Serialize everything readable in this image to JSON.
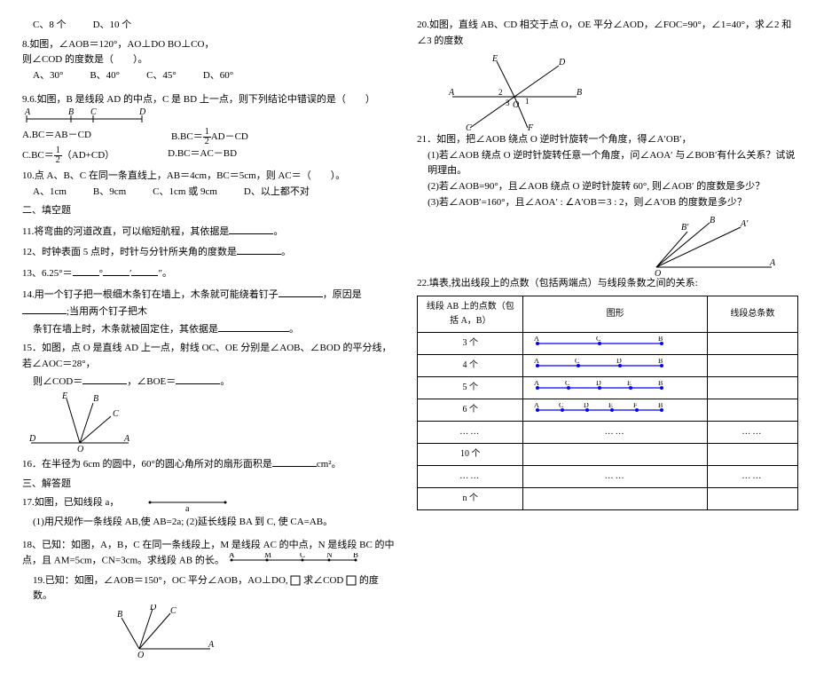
{
  "left": {
    "q7opts": {
      "c": "C、8 个",
      "d": "D、10 个"
    },
    "q8": {
      "line1": "8.如图，∠AOB＝120°，AO⊥DO BO⊥CO，",
      "line2": "则∠COD 的度数是（　　）。",
      "opts": {
        "a": "A、30°",
        "b": "B、40°",
        "c": "C、45°",
        "d": "D、60°"
      }
    },
    "q9": {
      "title": "9.6.如图，B 是线段 AD 的中点，C 是 BD 上一点，则下列结论中错误的是（　　）",
      "opts": {
        "a": "A.BC＝AB－CD",
        "b_pre": "B.BC＝",
        "b_post": "AD－CD",
        "c_pre": "C.BC＝",
        "c_post": "（AD+CD）",
        "d": "D.BC＝AC－BD"
      }
    },
    "q10": {
      "title": "10.点 A、B、C 在同一条直线上，AB＝4cm，BC＝5cm，则 AC＝（　　）。",
      "opts": {
        "a": "A、1cm",
        "b": "B、9cm",
        "c": "C、1cm 或 9cm",
        "d": "D、以上都不对"
      }
    },
    "fill_header": "二、填空题",
    "q11": "11.将弯曲的河道改直，可以缩短航程，其依据是",
    "q12": "12、时钟表面 5 点时，时针与分针所夹角的度数是",
    "q13_pre": "13、6.25°＝",
    "q13_mid": "°",
    "q13_mid2": "′",
    "q13_end": "″。",
    "q14_a": "14.用一个钉子把一根细木条钉在墙上，木条就可能绕着钉子",
    "q14_b": "，原因是",
    "q14_c": ";当用两个钉子把木",
    "q14_d": "条钉在墙上时，木条就被固定住，其依据是",
    "q15_a": "15．如图，点 O 是直线 AD 上一点，射线 OC、OE 分别是∠AOB、∠BOD 的平分线，若∠AOC＝28°，",
    "q15_b": "则∠COD＝",
    "q15_c": "，∠BOE＝",
    "q15_d": "。",
    "q16_a": "16．在半径为 6cm 的圆中，60°的圆心角所对的扇形面积是",
    "q16_b": "cm²。",
    "solve_header": "三、解答题",
    "q17": {
      "title": "17.如图，已知线段 a，",
      "sub": "(1)用尺规作一条线段 AB,使 AB=2a; (2)延长线段 BA 到 C, 使 CA=AB。"
    },
    "q18": "18、已知：如图，A，B，C 在同一条线段上，M 是线段 AC 的中点，N 是线段 BC 的中点，且 AM=5cm，CN=3cm。求线段 AB 的长。",
    "q19": "19.已知：如图，∠AOB＝150°，OC 平分∠AOB，AO⊥DO,",
    "q19_end": "的度数。",
    "q19_mid": "求∠COD"
  },
  "right": {
    "q20": "20.如图，直线 AB、CD 相交于点 O，OE 平分∠AOD，∠FOC=90°，∠1=40°，求∠2 和∠3 的度数",
    "q21": {
      "title": "21．如图，把∠AOB 绕点 O 逆时针旋转一个角度，得∠A′OB′，",
      "s1": "(1)若∠AOB 绕点 O 逆时针旋转任意一个角度，问∠AOA′ 与∠BOB′有什么关系？试说明理由。",
      "s2": "(2)若∠AOB=90°，且∠AOB 绕点 O 逆时针旋转 60°, 则∠AOB′ 的度数是多少？",
      "s3": "(3)若∠AOB′=160°，且∠AOA′ : ∠A′OB＝3 : 2，则∠A′OB 的度数是多少？"
    },
    "q22": {
      "title": "22.填表,找出线段上的点数（包括两端点）与线段条数之间的关系:",
      "h1": "线段 AB 上的点数（包括 A，B）",
      "h2": "图形",
      "h3": "线段总条数",
      "rows": [
        "3 个",
        "4 个",
        "5 个",
        "6 个",
        "……",
        "10 个",
        "……",
        "n 个"
      ],
      "dots": "……"
    }
  }
}
